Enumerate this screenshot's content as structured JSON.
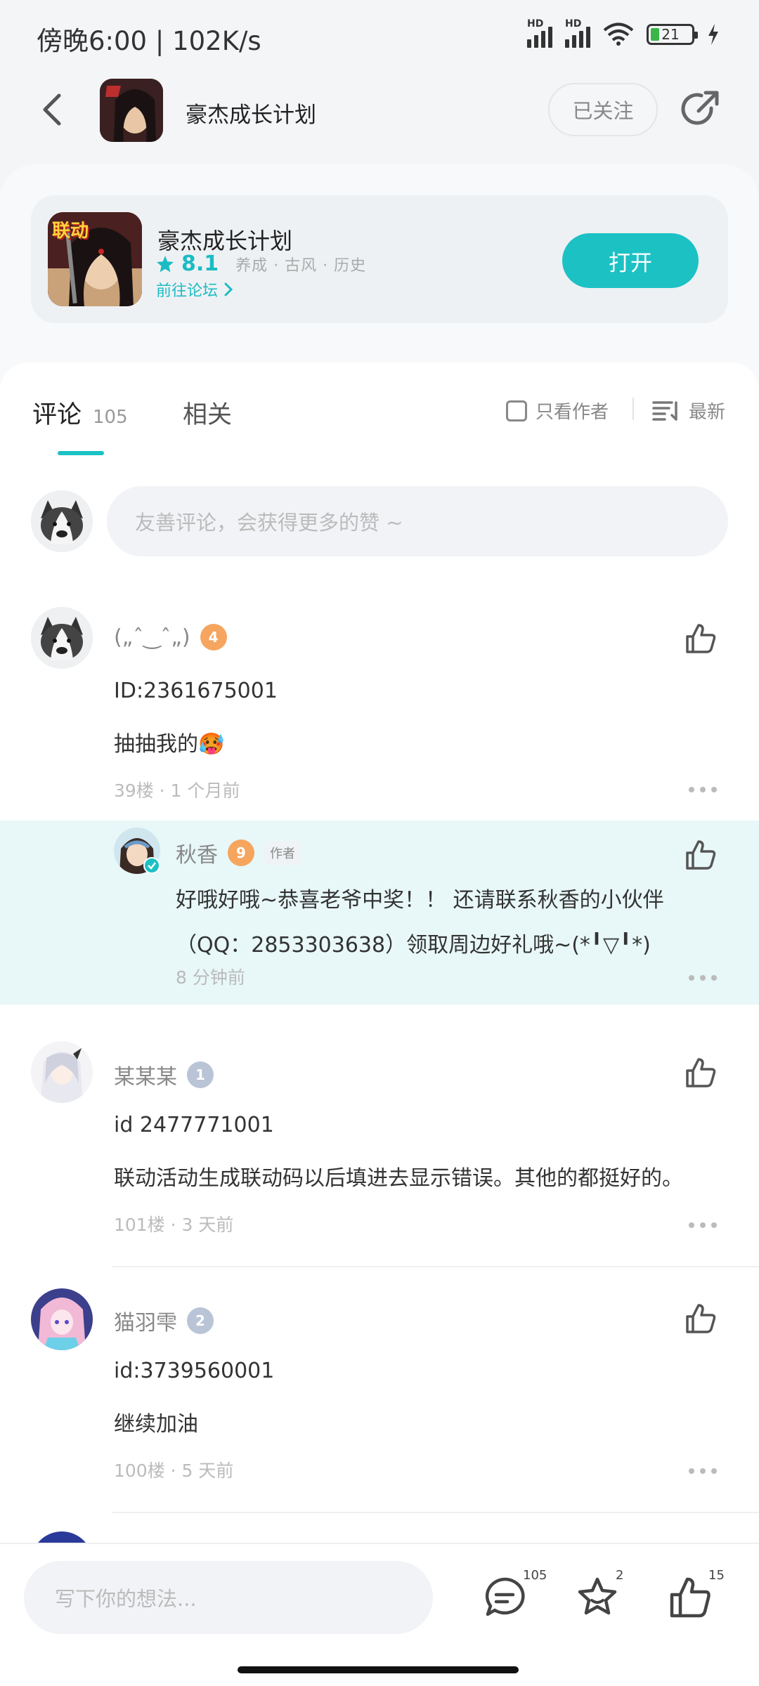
{
  "status_bar": {
    "time": "傍晚6:00 | 102K/s",
    "signal_1_label": "HD",
    "signal_2_label": "HD",
    "battery": "21",
    "battery_level": 0.21
  },
  "header": {
    "title": "豪杰成长计划",
    "follow_label": "已关注"
  },
  "app_card": {
    "badge": "联动",
    "name": "豪杰成长计划",
    "rating": "8.1",
    "tags": "养成 · 古风 · 历史",
    "forum_link": "前往论坛",
    "open_label": "打开"
  },
  "tabs": {
    "comments_label": "评论",
    "comments_count": "105",
    "related_label": "相关",
    "only_author": "只看作者",
    "sort": "最新"
  },
  "input": {
    "placeholder": "友善评论，会获得更多的赞 ~"
  },
  "comments": [
    {
      "name": "(„ˆ‿ˆ„)",
      "level": "4",
      "lines": [
        "ID:2361675001",
        "抽抽我的🥵"
      ],
      "meta": "39楼 · 1 个月前",
      "reply": {
        "name": "秋香",
        "level": "9",
        "tag": "作者",
        "line1": "好哦好哦~恭喜老爷中奖！！ 还请联系秋香的小伙伴",
        "line2": "（QQ：2853303638）领取周边好礼哦~(*╹▽╹*)",
        "meta": "8 分钟前"
      }
    },
    {
      "name": "某某某",
      "level": "1",
      "lines": [
        "id 2477771001",
        "联动活动生成联动码以后填进去显示错误。其他的都挺好的。"
      ],
      "meta": "101楼 · 3 天前"
    },
    {
      "name": "猫羽雫",
      "level": "2",
      "lines": [
        "id:3739560001",
        "继续加油"
      ],
      "meta": "100楼 · 5 天前"
    }
  ],
  "bottom_bar": {
    "placeholder": "写下你的想法...",
    "comment_count": "105",
    "favorite_count": "2",
    "like_count": "15"
  },
  "colors": {
    "accent": "#1cc1c4",
    "reply_bg": "#e8f7f7",
    "level_orange": "#f6a55f",
    "level_gray": "#b9c4d6"
  }
}
